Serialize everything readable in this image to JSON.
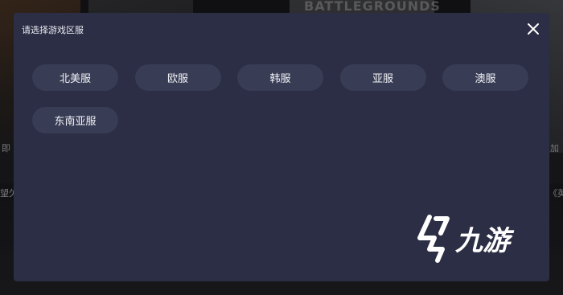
{
  "background": {
    "game_title": "BATTLEGROUNDS",
    "side_texts": [
      "即",
      "加",
      "望欠",
      "《英"
    ]
  },
  "modal": {
    "title": "请选择游戏区服",
    "close_icon": "close-icon",
    "regions": [
      "北美服",
      "欧服",
      "韩服",
      "亚服",
      "澳服",
      "东南亚服"
    ]
  },
  "watermark": {
    "text": "九游"
  },
  "colors": {
    "modal_bg": "#2b2e44",
    "option_bg": "#383c54",
    "text": "#f2f3f8"
  }
}
